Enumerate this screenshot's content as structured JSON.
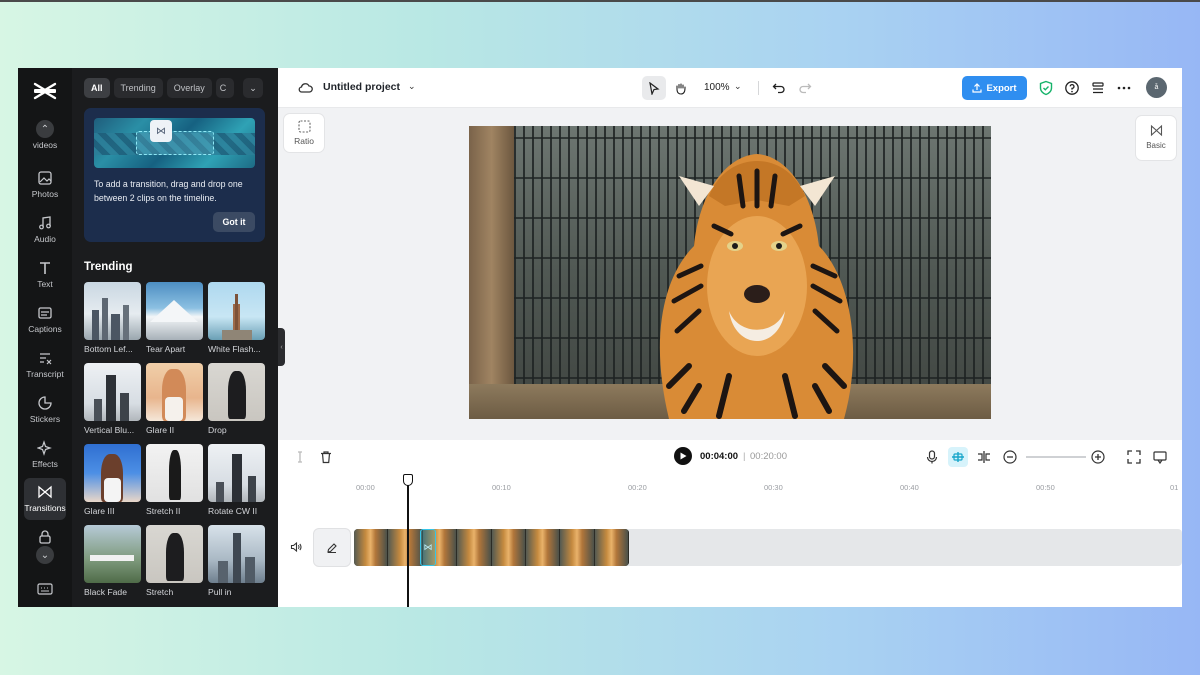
{
  "rail": {
    "items": [
      {
        "label": "videos"
      },
      {
        "label": "Photos"
      },
      {
        "label": "Audio"
      },
      {
        "label": "Text"
      },
      {
        "label": "Captions"
      },
      {
        "label": "Transcript"
      },
      {
        "label": "Stickers"
      },
      {
        "label": "Effects"
      },
      {
        "label": "Transitions"
      }
    ]
  },
  "panel": {
    "chips": [
      "All",
      "Trending",
      "Overlay",
      "C"
    ],
    "tip": {
      "text": "To add a transition, drag and drop one between 2 clips on the timeline.",
      "button": "Got it"
    },
    "section_title": "Trending",
    "cards": [
      {
        "label": "Bottom Lef..."
      },
      {
        "label": "Tear Apart"
      },
      {
        "label": "White Flash..."
      },
      {
        "label": "Vertical Blu..."
      },
      {
        "label": "Glare II"
      },
      {
        "label": "Drop"
      },
      {
        "label": "Glare III"
      },
      {
        "label": "Stretch II"
      },
      {
        "label": "Rotate CW II"
      },
      {
        "label": "Black Fade"
      },
      {
        "label": "Stretch"
      },
      {
        "label": "Pull in"
      }
    ]
  },
  "topbar": {
    "project_name": "Untitled project",
    "zoom": "100%",
    "export_label": "Export",
    "avatar_initials": "å"
  },
  "canvas": {
    "ratio_label": "Ratio",
    "basic_label": "Basic"
  },
  "timeline": {
    "current_time": "00:04:00",
    "separator": "|",
    "total_time": "00:20:00",
    "ruler": [
      "00:00",
      "00:10",
      "00:20",
      "00:30",
      "00:40",
      "00:50",
      "01"
    ]
  },
  "colors": {
    "accent": "#2f8ef0",
    "transition_highlight": "#35c5e8"
  }
}
